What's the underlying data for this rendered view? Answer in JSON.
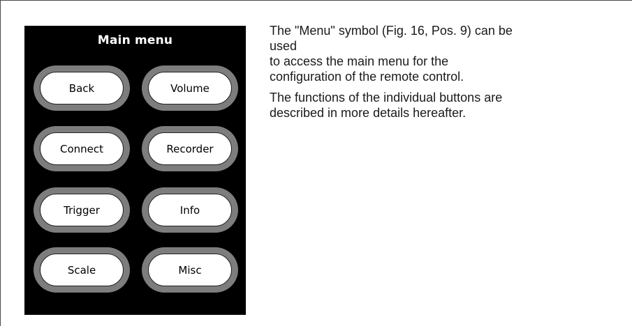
{
  "device_menu": {
    "title": "Main menu",
    "buttons": {
      "back": "Back",
      "volume": "Volume",
      "connect": "Connect",
      "recorder": "Recorder",
      "trigger": "Trigger",
      "info": "Info",
      "scale": "Scale",
      "misc": "Misc"
    }
  },
  "description": {
    "paragraph_1": {
      "line_1": "The \"Menu\" symbol (Fig. 16, Pos. 9) can be",
      "line_2": "used",
      "line_3": "to access the main menu for the",
      "line_4": "configuration of the remote control."
    },
    "paragraph_2": {
      "line_1": "The functions of the individual buttons are",
      "line_2": "described in more details hereafter."
    }
  }
}
